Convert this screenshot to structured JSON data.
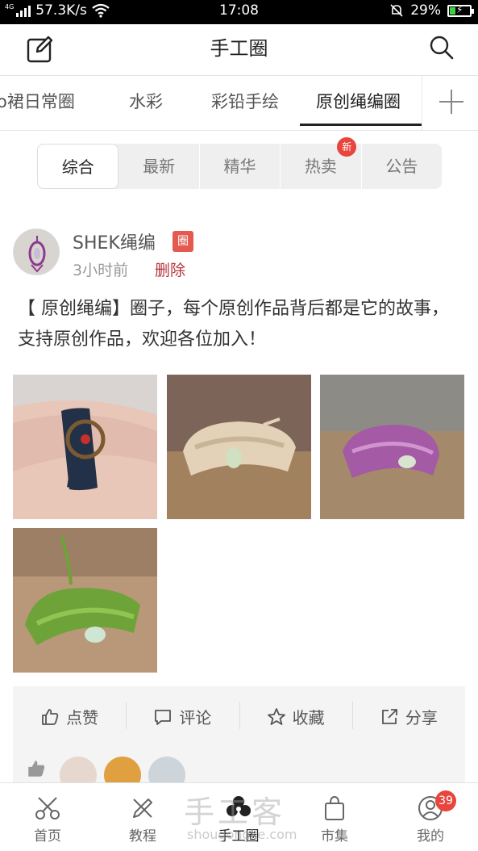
{
  "status_bar": {
    "net_type": "4G",
    "net_speed": "57.3K/s",
    "time": "17:08",
    "battery": "29%",
    "battery_level": 0.29
  },
  "header": {
    "title": "手工圈",
    "edit_icon": "edit-icon",
    "search_icon": "search-icon"
  },
  "circle_tabs": [
    "o裙日常圈",
    "水彩",
    "彩铅手绘",
    "原创绳编圈"
  ],
  "circle_tab_active": "原创绳编圈",
  "filter_tabs": {
    "items": [
      "综合",
      "最新",
      "精华",
      "热卖",
      "公告"
    ],
    "active": "综合",
    "new_badge": "新"
  },
  "post": {
    "username": "SHEK绳编",
    "owner_badge": "圈",
    "time": "3小时前",
    "delete_label": "删除",
    "content": "【 原创绳编】圈子，每个原创作品背后都是它的故事，支持原创作品，欢迎各位加入！",
    "photos": [
      "black-braided-bracelet-with-flower",
      "beige-braided-bracelet-with-jade",
      "purple-braided-bracelet-with-jade",
      "green-braided-bracelet-with-jade"
    ]
  },
  "actions": {
    "like": "点赞",
    "comment": "评论",
    "favorite": "收藏",
    "share": "分享"
  },
  "bottom_nav": {
    "items": [
      "首页",
      "教程",
      "手工圈",
      "市集",
      "我的"
    ],
    "active": "手工圈",
    "profile_badge": "39"
  },
  "watermark": {
    "main": "手工客",
    "sub": "shougongke.com"
  },
  "colors": {
    "accent_red": "#e8453c",
    "delete_red": "#b7343b",
    "text_dark": "#222222"
  }
}
